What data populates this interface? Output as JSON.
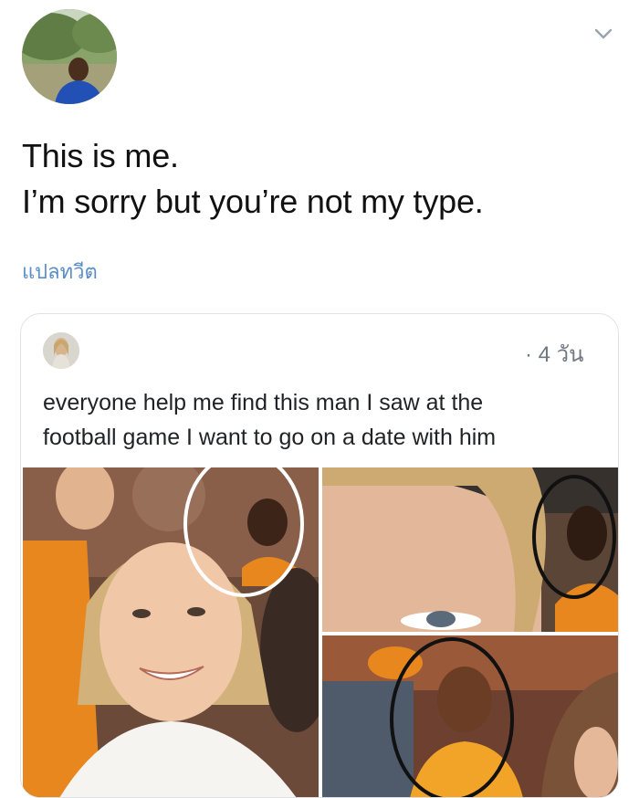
{
  "tweet": {
    "line1": "This is me.",
    "line2": "I’m sorry but you’re not my type.",
    "translate_label": "แปลทวีต"
  },
  "quoted_tweet": {
    "timestamp": "· 4 วัน",
    "text_line1": "everyone help me find this man I saw at the",
    "text_line2": "football game I want to go on a date with him"
  },
  "icons": {
    "menu": "chevron-down-icon"
  },
  "colors": {
    "link": "#5b8ec9",
    "card_border": "#dfe3e8",
    "jersey_orange": "#e8871e"
  }
}
